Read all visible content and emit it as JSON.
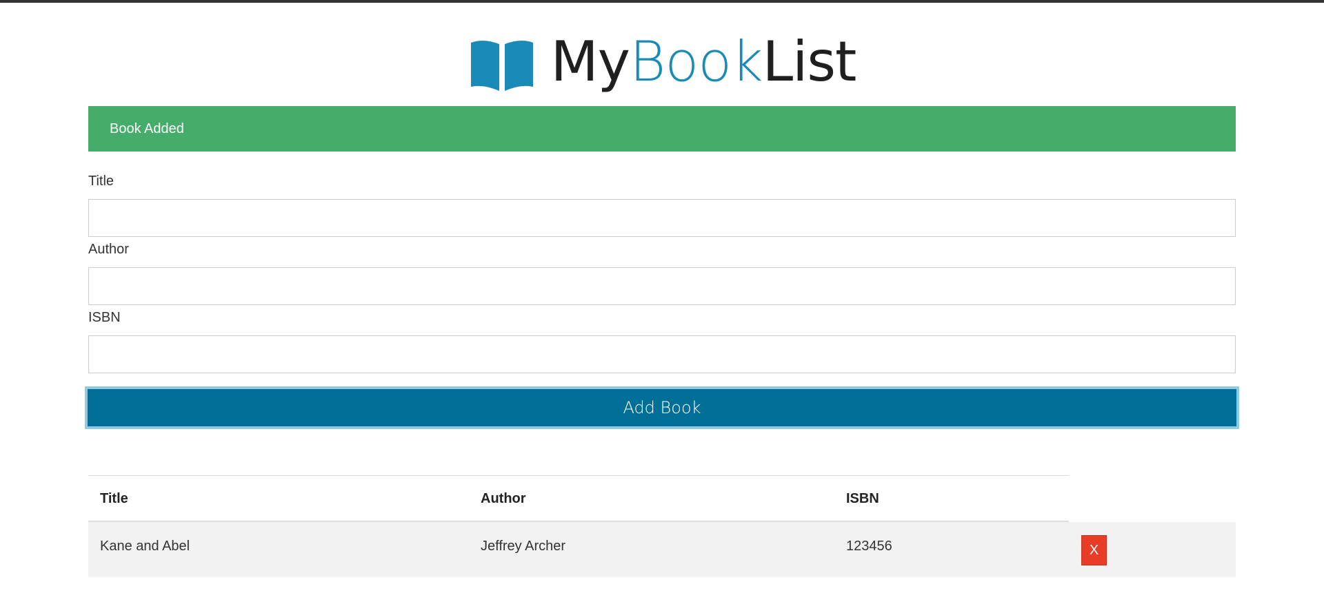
{
  "logo": {
    "part1": "My",
    "part2": "Book",
    "part3": "List",
    "icon": "book-open-icon",
    "colors": {
      "dark": "#1f1f1f",
      "blue": "#1a8ab8"
    }
  },
  "alert": {
    "message": "Book Added",
    "color": "#45ad6a"
  },
  "form": {
    "title_label": "Title",
    "title_value": "",
    "author_label": "Author",
    "author_value": "",
    "isbn_label": "ISBN",
    "isbn_value": "",
    "submit_label": "Add Book",
    "submit_color": "#006f97"
  },
  "table": {
    "headers": [
      "Title",
      "Author",
      "ISBN"
    ],
    "rows": [
      {
        "title": "Kane and Abel",
        "author": "Jeffrey Archer",
        "isbn": "123456",
        "delete_label": "X"
      }
    ],
    "delete_color": "#e83c26"
  }
}
